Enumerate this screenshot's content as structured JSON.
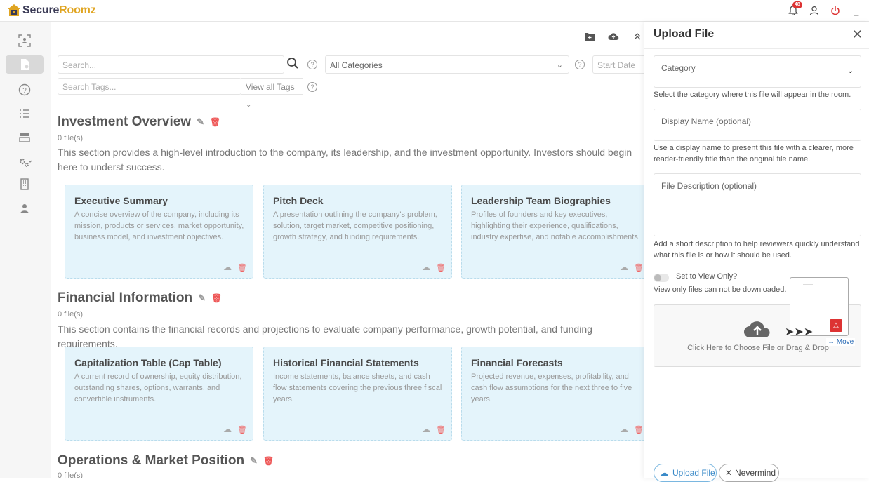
{
  "app": {
    "logo_part1": "Secure",
    "logo_part2": "Roomz",
    "notification_count": "48"
  },
  "toolbar": {
    "search_placeholder": "Search...",
    "category_select": "All Categories",
    "start_date_placeholder": "Start Date",
    "tags_placeholder": "Search Tags...",
    "view_tags_label": "View all Tags"
  },
  "sections": [
    {
      "title": "Investment Overview",
      "count": "0 file(s)",
      "description": "This section provides a high-level introduction to the company, its leadership, and the investment opportunity. Investors should begin here to underst success.",
      "cards": [
        {
          "title": "Executive Summary",
          "desc": "A concise overview of the company, including its mission, products or services, market opportunity, business model, and investment objectives."
        },
        {
          "title": "Pitch Deck",
          "desc": "A presentation outlining the company's problem, solution, target market, competitive positioning, growth strategy, and funding requirements."
        },
        {
          "title": "Leadership Team Biographies",
          "desc": "Profiles of founders and key executives, highlighting their experience, qualifications, industry expertise, and notable accomplishments."
        }
      ]
    },
    {
      "title": "Financial Information",
      "count": "0 file(s)",
      "description": "This section contains the financial records and projections to evaluate company performance, growth potential, and funding requirements.",
      "cards": [
        {
          "title": "Capitalization Table (Cap Table)",
          "desc": "A current record of ownership, equity distribution, outstanding shares, options, warrants, and convertible instruments."
        },
        {
          "title": "Historical Financial Statements",
          "desc": "Income statements, balance sheets, and cash flow statements covering the previous three fiscal years."
        },
        {
          "title": "Financial Forecasts",
          "desc": "Projected revenue, expenses, profitability, and cash flow assumptions for the next three to five years."
        }
      ]
    },
    {
      "title": "Operations & Market Position",
      "count": "0 file(s)"
    }
  ],
  "upload_panel": {
    "title": "Upload File",
    "category_label": "Category",
    "category_hint": "Select the category where this file will appear in the room.",
    "display_name_placeholder": "Display Name (optional)",
    "display_name_hint": "Use a display name to present this file with a clearer, more reader-friendly title than the original file name.",
    "description_placeholder": "File Description (optional)",
    "description_hint": "Add a short description to help reviewers quickly understand what this file is or how it should be used.",
    "view_only_label": "Set to View Only?",
    "view_only_note": "View only files can not be downloaded.",
    "dropzone_text": "Click Here to Choose File or Drag & Drop",
    "move_label": "Move",
    "upload_button": "Upload File",
    "nevermind_button": "Nevermind"
  }
}
